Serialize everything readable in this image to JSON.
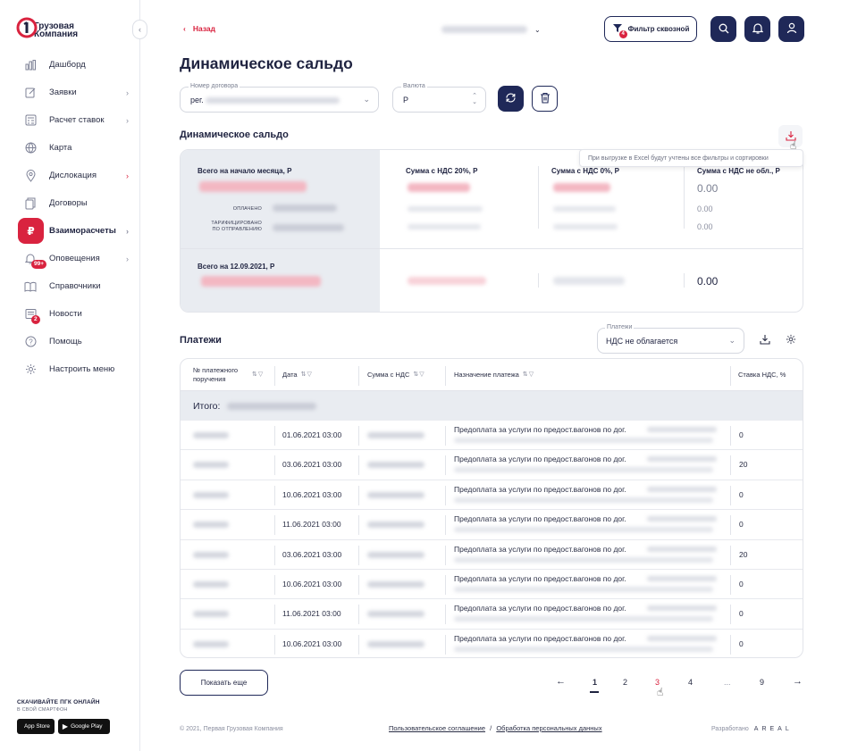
{
  "brand": {
    "logo_text_1": "Грузовая",
    "logo_text_2": "Компания",
    "accent": "#d9233f",
    "navy": "#1f2858"
  },
  "sidebar": {
    "collapse_icon": "chevron-left-icon",
    "items": [
      {
        "label": "Дашборд",
        "icon": "chart-icon",
        "chevron": false
      },
      {
        "label": "Заявки",
        "icon": "edit-icon",
        "chevron": true
      },
      {
        "label": "Расчет ставок",
        "icon": "calculator-icon",
        "chevron": true
      },
      {
        "label": "Карта",
        "icon": "globe-icon",
        "chevron": false
      },
      {
        "label": "Дислокация",
        "icon": "location-icon",
        "chevron": true
      },
      {
        "label": "Договоры",
        "icon": "documents-icon",
        "chevron": false
      },
      {
        "label": "Взаиморасчеты",
        "icon": "ruble-icon",
        "chevron": true,
        "active": true
      },
      {
        "label": "Оповещения",
        "icon": "bell-icon",
        "chevron": true,
        "badge": "99+"
      },
      {
        "label": "Справочники",
        "icon": "book-icon",
        "chevron": false
      },
      {
        "label": "Новости",
        "icon": "news-icon",
        "chevron": false,
        "badge": "2"
      },
      {
        "label": "Помощь",
        "icon": "help-icon",
        "chevron": false
      },
      {
        "label": "Настроить меню",
        "icon": "gear-icon",
        "chevron": false
      }
    ],
    "promo_title": "СКАЧИВАЙТЕ ПГК ОНЛАЙН",
    "promo_sub": "В СВОЙ СМАРТФОН",
    "app_store": "App Store",
    "google_play": "Google Play"
  },
  "header": {
    "back_label": "Назад",
    "filter_label": "Фильтр сквозной",
    "filter_badge": "4"
  },
  "page": {
    "title": "Динамическое сальдо"
  },
  "filters": {
    "contract_label": "Номер договора",
    "contract_value": "рег.",
    "currency_label": "Валюта",
    "currency_value": "Р"
  },
  "saldo": {
    "section_title": "Динамическое сальдо",
    "tooltip": "При выгрузке в Excel будут учтены  все фильтры и сортировки",
    "start_label": "Всего на начало месяца, Р",
    "paid_label": "ОПЛАЧЕНО",
    "tariffed_label_1": "ТАРИФИЦИРОВАНО",
    "tariffed_label_2": "ПО ОТПРАВЛЕНИЮ",
    "end_label": "Всего на 12.09.2021, Р",
    "col_vat20": "Сумма с НДС 20%, Р",
    "col_vat0": "Сумма с НДС 0%, Р",
    "col_novat": "Сумма с НДС не обл., Р",
    "novat_total": "0.00",
    "novat_paid": "0.00",
    "novat_tariffed": "0.00",
    "novat_end": "0.00"
  },
  "payments": {
    "title": "Платежи",
    "select_label": "Платежи",
    "select_value": "НДС не облагается",
    "columns": [
      "№ платежного поручения",
      "Дата",
      "Сумма с НДС",
      "Назначение платежа",
      "Ставка НДС, %"
    ],
    "total_label": "Итого:",
    "purpose_prefix": "Предоплата за услуги по предост.вагонов по дог.",
    "rows": [
      {
        "date": "01.06.2021 03:00",
        "rate": "0"
      },
      {
        "date": "03.06.2021 03:00",
        "rate": "20"
      },
      {
        "date": "10.06.2021 03:00",
        "rate": "0"
      },
      {
        "date": "11.06.2021 03:00",
        "rate": "0"
      },
      {
        "date": "03.06.2021 03:00",
        "rate": "20"
      },
      {
        "date": "10.06.2021 03:00",
        "rate": "0"
      },
      {
        "date": "11.06.2021 03:00",
        "rate": "0"
      },
      {
        "date": "10.06.2021 03:00",
        "rate": "0"
      }
    ],
    "show_more": "Показать еще",
    "pagination": [
      "1",
      "2",
      "3",
      "4",
      "...",
      "9"
    ],
    "current_page": "1"
  },
  "footer": {
    "copyright": "© 2021, Первая Грузовая Компания",
    "agreement": "Пользовательское соглашение",
    "separator": "/",
    "privacy": "Обработка персональных данных",
    "developed_by": "Разработано",
    "developer": "AREAL"
  }
}
